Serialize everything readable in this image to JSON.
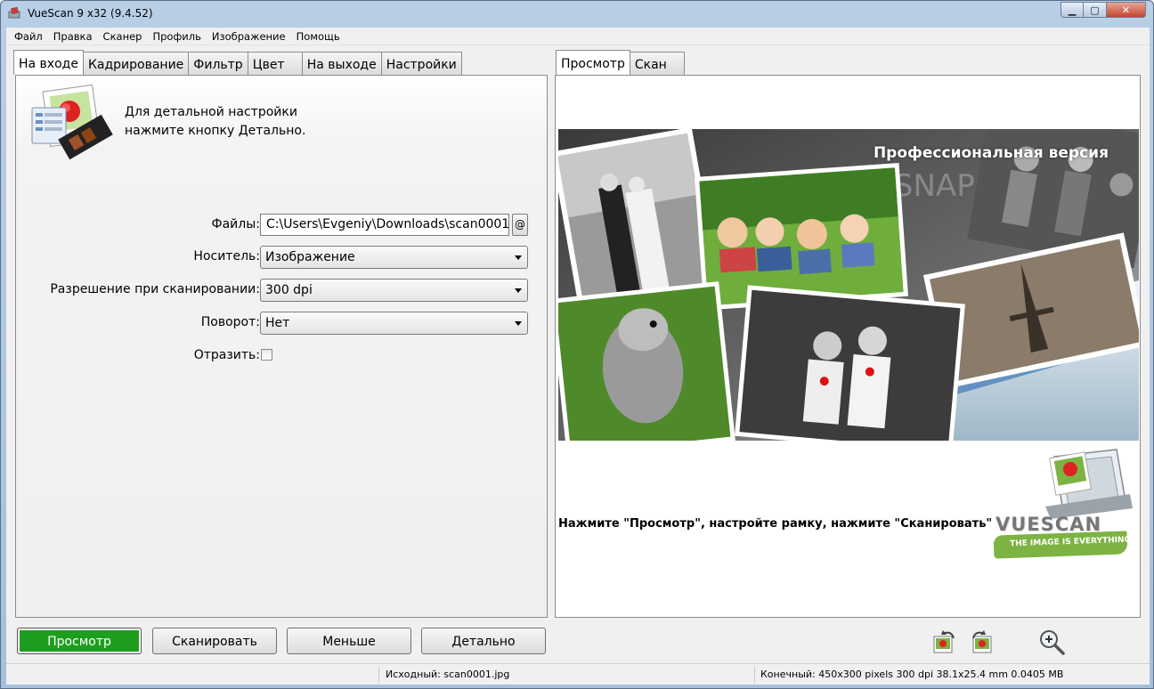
{
  "window": {
    "title": "VueScan 9 x32 (9.4.52)"
  },
  "menu": [
    "Файл",
    "Правка",
    "Сканер",
    "Профиль",
    "Изображение",
    "Помощь"
  ],
  "left_tabs": [
    {
      "label": "На входе",
      "active": true
    },
    {
      "label": "Кадрирование",
      "active": false
    },
    {
      "label": "Фильтр",
      "active": false
    },
    {
      "label": "Цвет",
      "active": false
    },
    {
      "label": "На выходе",
      "active": false
    },
    {
      "label": "Настройки",
      "active": false
    }
  ],
  "help": {
    "line1": "Для детальной настройки",
    "line2": "нажмите кнопку Детально."
  },
  "form": {
    "files_label": "Файлы:",
    "files_value": "C:\\Users\\Evgeniy\\Downloads\\scan0001",
    "files_at": "@",
    "media_label": "Носитель:",
    "media_value": "Изображение",
    "resolution_label": "Разрешение при сканировании:",
    "resolution_value": "300 dpi",
    "rotation_label": "Поворот:",
    "rotation_value": "Нет",
    "mirror_label": "Отразить:",
    "mirror_checked": false
  },
  "right_tabs": [
    {
      "label": "Просмотр",
      "active": true
    },
    {
      "label": "Скан",
      "active": false
    }
  ],
  "promo": {
    "title": "Профессиональная версия"
  },
  "hint": "Нажмите \"Просмотр\", настройте рамку, нажмите \"Сканировать\"",
  "logo": {
    "word": "VUESCAN",
    "tagline": "THE IMAGE IS EVERYTHING"
  },
  "buttons": {
    "preview": "Просмотр",
    "scan": "Сканировать",
    "less": "Меньше",
    "more": "Детально"
  },
  "status": {
    "source": "Исходный: scan0001.jpg",
    "output": "Конечный: 450x300 pixels 300 dpi 38.1x25.4 mm 0.0405 MB"
  },
  "colors": {
    "accent_green": "#1e9e1e",
    "logo_green": "#7cb342"
  }
}
